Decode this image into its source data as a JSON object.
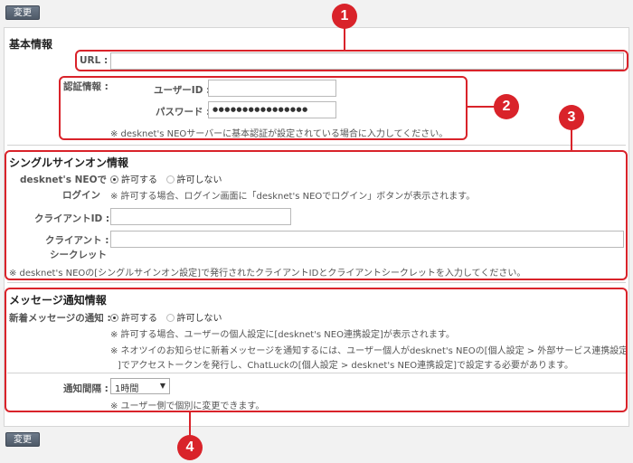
{
  "buttons": {
    "top_change": "変更",
    "bottom_change": "変更"
  },
  "basic": {
    "title": "基本情報",
    "url_label": "URL :",
    "url_value": "",
    "auth_label": "認証情報 :",
    "user_id_label": "ユーザーID :",
    "user_id_value": "",
    "password_label": "パスワード :",
    "password_value": "●●●●●●●●●●●●●●●●",
    "auth_note": "※ desknet's NEOサーバーに基本認証が設定されている場合に入力してください。"
  },
  "sso": {
    "title": "シングルサインオン情報",
    "login_label_1": "desknet's NEOで :",
    "login_label_2": "ログイン",
    "allow": "許可する",
    "deny": "許可しない",
    "login_note": "※ 許可する場合、ログイン画面に「desknet's NEOでログイン」ボタンが表示されます。",
    "client_id_label": "クライアントID :",
    "client_id_value": "",
    "client_secret_label_1": "クライアント :",
    "client_secret_label_2": "シークレット",
    "client_secret_value": "",
    "note": "※ desknet's NEOの[シングルサインオン設定]で発行されたクライアントIDとクライアントシークレットを入力してください。"
  },
  "message": {
    "title": "メッセージ通知情報",
    "notify_label": "新着メッセージの通知 :",
    "allow": "許可する",
    "deny": "許可しない",
    "note1": "※ 許可する場合、ユーザーの個人設定に[desknet's NEO連携設定]が表示されます。",
    "note2_line1": "※ ネオツイのお知らせに新着メッセージを通知するには、ユーザー個人がdesknet's NEOの[個人設定 > 外部サービス連携設定",
    "note2_line2": "]でアクセストークンを発行し、ChatLuckの[個人設定 > desknet's NEO連携設定]で設定する必要があります。",
    "interval_label": "通知間隔 :",
    "interval_value": "1時間",
    "interval_note": "※ ユーザー側で個別に変更できます。"
  },
  "callouts": [
    "1",
    "2",
    "3",
    "4"
  ],
  "colors": {
    "callout_red": "#d9232a",
    "button_bg": "#56616f"
  }
}
